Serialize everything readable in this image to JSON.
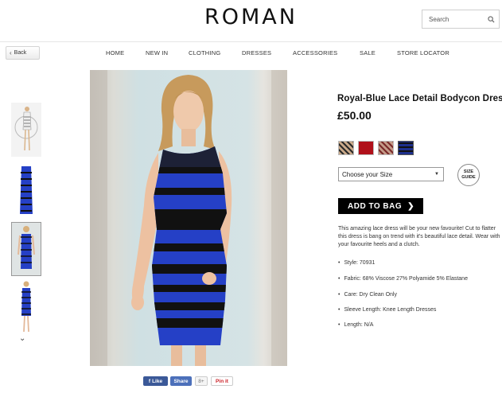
{
  "header": {
    "logo": "ROMAN",
    "search_placeholder": "Search"
  },
  "back": {
    "label": "Back"
  },
  "nav": {
    "items": [
      "HOME",
      "NEW IN",
      "CLOTHING",
      "DRESSES",
      "ACCESSORIES",
      "SALE",
      "STORE LOCATOR"
    ]
  },
  "gallery": {
    "thumbnail_count": 4,
    "selected_index": 2,
    "down_arrow": "⌄"
  },
  "social": {
    "like": "Like",
    "share": "Share",
    "gplus": "8+",
    "pin": "Pin it"
  },
  "product": {
    "title": "Royal-Blue Lace Detail Bodycon Dress",
    "price": "£50.00",
    "swatches": [
      "#c9a98a",
      "#b0101a",
      "#b98e80",
      "#1d2f8c"
    ],
    "size_select": "Choose your Size",
    "size_guide": "SIZE GUIDE",
    "add_to_bag": "ADD TO BAG",
    "description": "This amazing lace dress will be your new favourite! Cut to flatter this dress is bang on trend with it's beautiful lace detail. Wear with your favourite heels and a clutch.",
    "specs": [
      "Style: 70931",
      "Fabric: 68% Viscose 27% Polyamide 5% Elastane",
      "Care: Dry Clean Only",
      "Sleeve Length: Knee Length Dresses",
      "Length: N/A"
    ]
  },
  "colors": {
    "dress_blue": "#2540c6",
    "lace_black": "#111111",
    "facebook": "#3b5998",
    "pinterest": "#cb2027"
  }
}
